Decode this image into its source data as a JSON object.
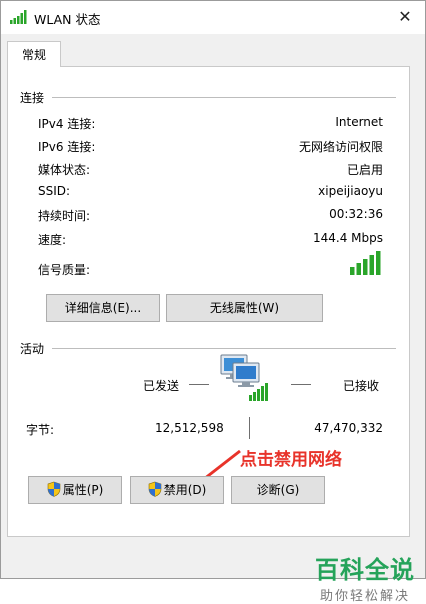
{
  "window": {
    "title": "WLAN 状态"
  },
  "tabs": [
    {
      "label": "常规"
    }
  ],
  "connection": {
    "group_title": "连接",
    "rows": [
      {
        "label": "IPv4 连接:",
        "value": "Internet"
      },
      {
        "label": "IPv6 连接:",
        "value": "无网络访问权限"
      },
      {
        "label": "媒体状态:",
        "value": "已启用"
      },
      {
        "label": "SSID:",
        "value": "xipeijiaoyu"
      },
      {
        "label": "持续时间:",
        "value": "00:32:36"
      },
      {
        "label": "速度:",
        "value": "144.4 Mbps"
      }
    ],
    "signal_label": "信号质量:",
    "signal_bars": 5,
    "buttons": {
      "details": "详细信息(E)...",
      "wireless": "无线属性(W)"
    }
  },
  "activity": {
    "group_title": "活动",
    "sent_label": "已发送",
    "received_label": "已接收",
    "bytes_label": "字节:",
    "bytes_sent": "12,512,598",
    "bytes_received": "47,470,332"
  },
  "bottom_buttons": {
    "properties": "属性(P)",
    "disable": "禁用(D)",
    "diagnose": "诊断(G)"
  },
  "annotation": {
    "text": "点击禁用网络",
    "color": "#e8332a"
  },
  "watermark": {
    "main": "百科全说",
    "sub": "助你轻松解决"
  },
  "colors": {
    "signal": "#2aa52a",
    "accent": "#e8332a",
    "watermark": "#25a35a"
  }
}
